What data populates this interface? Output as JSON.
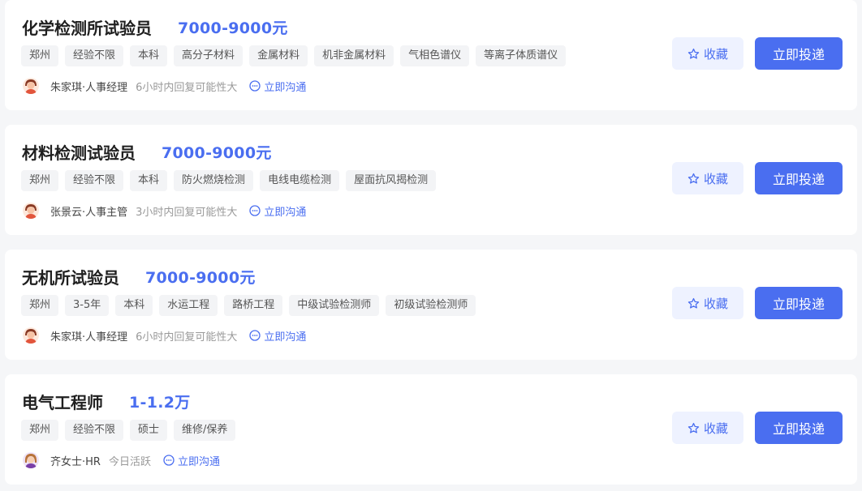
{
  "jobs": [
    {
      "title": "化学检测所试验员",
      "salary": "7000-9000元",
      "tags": [
        "郑州",
        "经验不限",
        "本科",
        "高分子材料",
        "金属材料",
        "机非金属材料",
        "气相色谱仪",
        "等离子体质谱仪"
      ],
      "hr": "朱家琪·人事经理",
      "reply": "6小时内回复可能性大",
      "chat_label": "立即沟通",
      "fav_label": "收藏",
      "apply_label": "立即投递"
    },
    {
      "title": "材料检测试验员",
      "salary": "7000-9000元",
      "tags": [
        "郑州",
        "经验不限",
        "本科",
        "防火燃烧检测",
        "电线电缆检测",
        "屋面抗风揭检测"
      ],
      "hr": "张景云·人事主管",
      "reply": "3小时内回复可能性大",
      "chat_label": "立即沟通",
      "fav_label": "收藏",
      "apply_label": "立即投递"
    },
    {
      "title": "无机所试验员",
      "salary": "7000-9000元",
      "tags": [
        "郑州",
        "3-5年",
        "本科",
        "水运工程",
        "路桥工程",
        "中级试验检测师",
        "初级试验检测师"
      ],
      "hr": "朱家琪·人事经理",
      "reply": "6小时内回复可能性大",
      "chat_label": "立即沟通",
      "fav_label": "收藏",
      "apply_label": "立即投递"
    },
    {
      "title": "电气工程师",
      "salary": "1-1.2万",
      "tags": [
        "郑州",
        "经验不限",
        "硕士",
        "维修/保养"
      ],
      "hr": "齐女士·HR",
      "reply": "今日活跃",
      "chat_label": "立即沟通",
      "fav_label": "收藏",
      "apply_label": "立即投递"
    }
  ],
  "colors": {
    "accent": "#4a6ef0",
    "fav_bg": "#eef2ff",
    "tag_bg": "#f3f4f6",
    "page_bg": "#f5f6f8"
  },
  "icons": {
    "favorite": "star-outline-icon",
    "chat": "chat-bubble-icon",
    "avatar": "person-avatar-icon"
  }
}
